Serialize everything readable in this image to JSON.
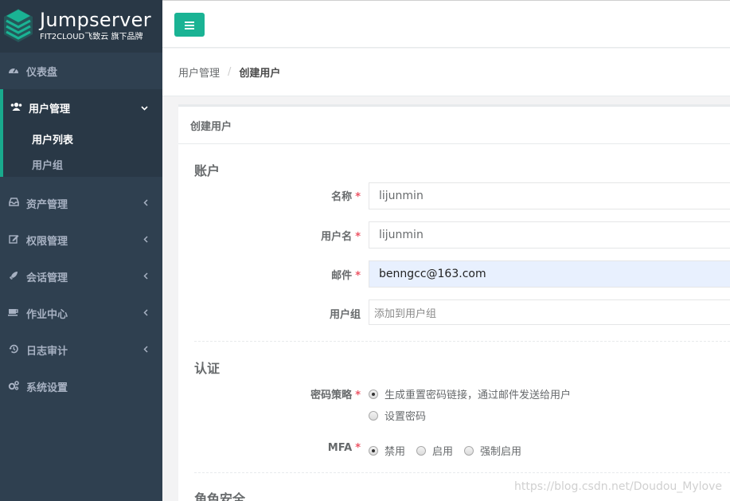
{
  "brand": {
    "title": "Jumpserver",
    "subtitle": "FIT2CLOUD飞致云 旗下品牌"
  },
  "sidebar": {
    "items": [
      {
        "label": "仪表盘",
        "icon": "dashboard-icon"
      },
      {
        "label": "用户管理",
        "icon": "users-icon",
        "expanded": true,
        "children": [
          {
            "label": "用户列表",
            "active": true
          },
          {
            "label": "用户组",
            "active": false
          }
        ]
      },
      {
        "label": "资产管理",
        "icon": "inbox-icon"
      },
      {
        "label": "权限管理",
        "icon": "edit-icon"
      },
      {
        "label": "会话管理",
        "icon": "rocket-icon"
      },
      {
        "label": "作业中心",
        "icon": "coffee-icon"
      },
      {
        "label": "日志审计",
        "icon": "history-icon"
      },
      {
        "label": "系统设置",
        "icon": "cogs-icon"
      }
    ]
  },
  "breadcrumb": {
    "parent": "用户管理",
    "separator": "/",
    "current": "创建用户"
  },
  "panel": {
    "title": "创建用户"
  },
  "form": {
    "account_section": "账户",
    "name_label": "名称",
    "name_value": "lijunmin",
    "username_label": "用户名",
    "username_value": "lijunmin",
    "email_label": "邮件",
    "email_value": "benngcc@163.com",
    "group_label": "用户组",
    "group_placeholder": "添加到用户组",
    "required_mark": "*",
    "auth_section": "认证",
    "password_strategy_label": "密码策略",
    "password_options": [
      {
        "label": "生成重置密码链接，通过邮件发送给用户",
        "checked": true
      },
      {
        "label": "设置密码",
        "checked": false
      }
    ],
    "mfa_label": "MFA",
    "mfa_options": [
      {
        "label": "禁用",
        "checked": true
      },
      {
        "label": "启用",
        "checked": false
      },
      {
        "label": "强制启用",
        "checked": false
      }
    ],
    "role_section": "角色安全"
  },
  "watermark": "https://blog.csdn.net/Doudou_Mylove",
  "colors": {
    "sidebar_bg": "#2f4050",
    "sidebar_dark": "#293846",
    "accent": "#1ab394",
    "required": "#ed5565",
    "autofill": "#e8f0fe"
  }
}
